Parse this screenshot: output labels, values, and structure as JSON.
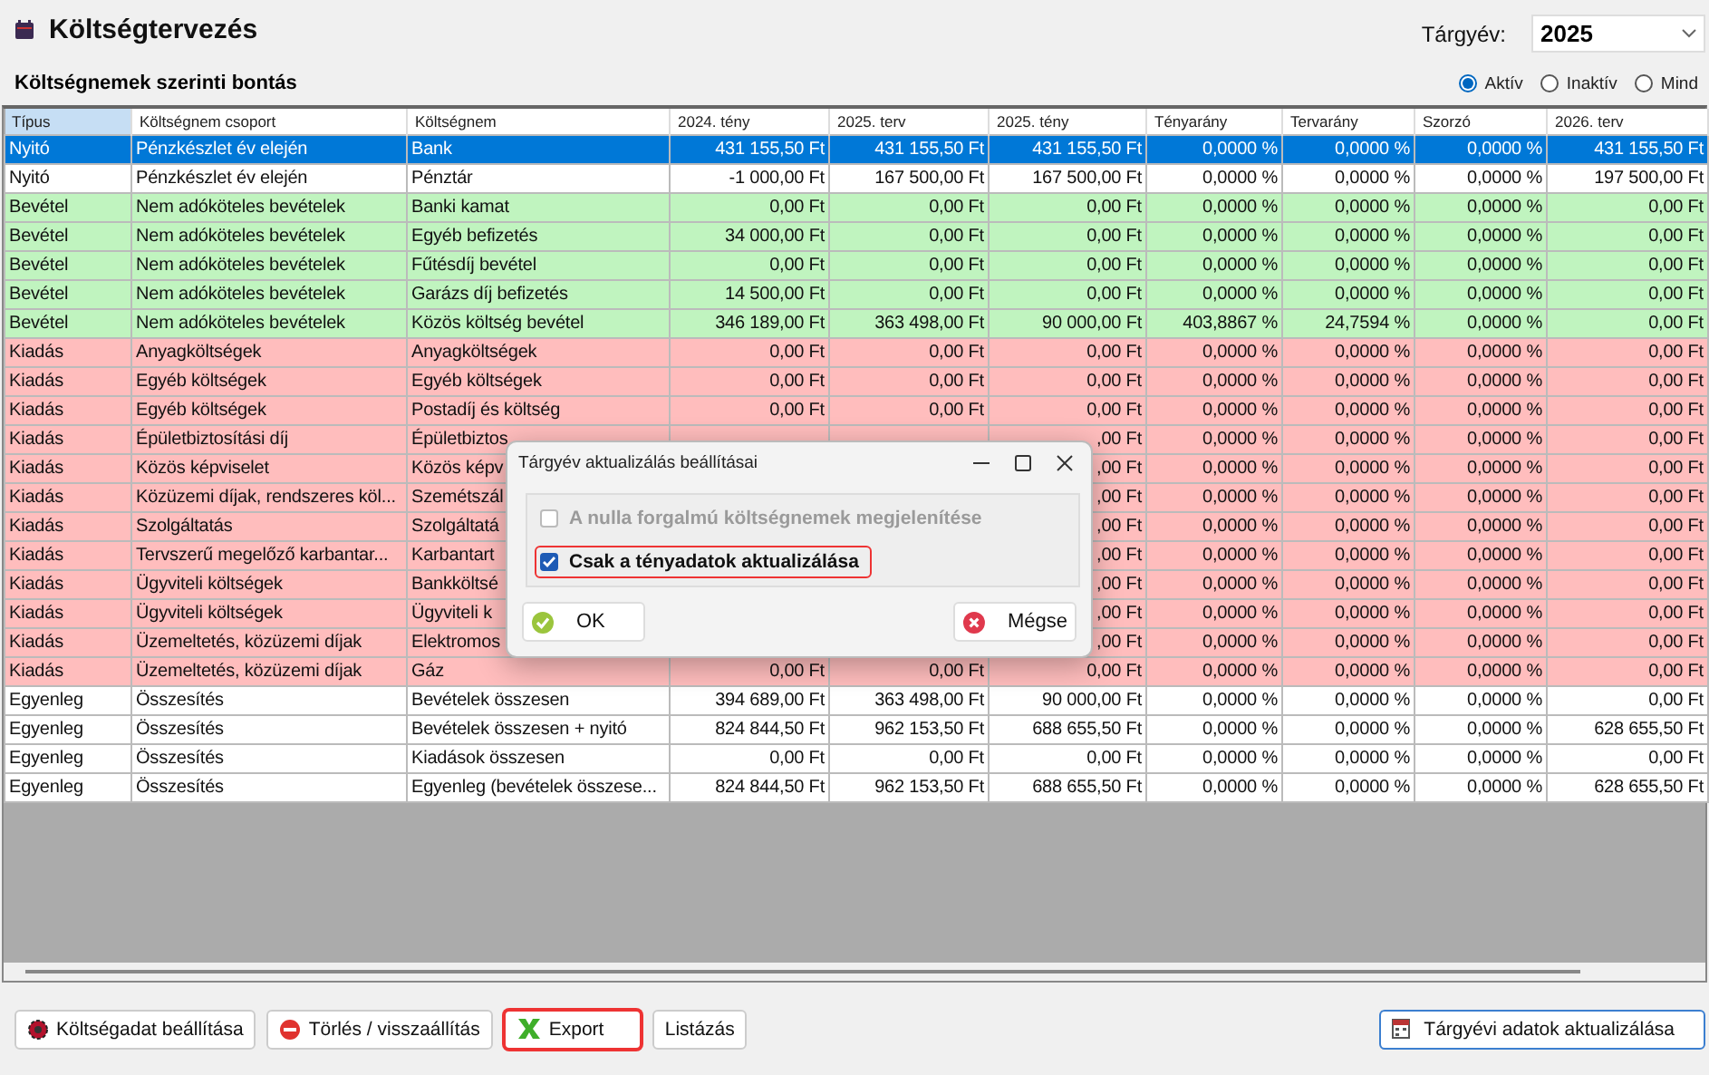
{
  "window": {
    "title": "Költségtervezés"
  },
  "year": {
    "label": "Tárgyév:",
    "value": "2025"
  },
  "section_title": "Költségnemek szerinti bontás",
  "filters": [
    {
      "label": "Aktív",
      "selected": true
    },
    {
      "label": "Inaktív",
      "selected": false
    },
    {
      "label": "Mind",
      "selected": false
    }
  ],
  "table": {
    "columns": [
      {
        "label": "Típus",
        "selected": true
      },
      {
        "label": "Költségnem csoport",
        "selected": false
      },
      {
        "label": "Költségnem",
        "selected": false
      },
      {
        "label": "2024. tény",
        "selected": false
      },
      {
        "label": "2025. terv",
        "selected": false
      },
      {
        "label": "2025. tény",
        "selected": false
      },
      {
        "label": "Tényarány",
        "selected": false
      },
      {
        "label": "Tervarány",
        "selected": false
      },
      {
        "label": "Szorzó",
        "selected": false
      },
      {
        "label": "2026. terv",
        "selected": false
      }
    ],
    "rows": [
      {
        "kind": "plain",
        "selected": true,
        "cells": [
          "Nyitó",
          "Pénzkészlet év elején",
          "Bank",
          "431 155,50 Ft",
          "431 155,50 Ft",
          "431 155,50 Ft",
          "0,0000 %",
          "0,0000 %",
          "0,0000 %",
          "431 155,50 Ft"
        ]
      },
      {
        "kind": "plain",
        "selected": false,
        "cells": [
          "Nyitó",
          "Pénzkészlet év elején",
          "Pénztár",
          "-1 000,00 Ft",
          "167 500,00 Ft",
          "167 500,00 Ft",
          "0,0000 %",
          "0,0000 %",
          "0,0000 %",
          "197 500,00 Ft"
        ]
      },
      {
        "kind": "income",
        "selected": false,
        "cells": [
          "Bevétel",
          "Nem adóköteles bevételek",
          "Banki kamat",
          "0,00 Ft",
          "0,00 Ft",
          "0,00 Ft",
          "0,0000 %",
          "0,0000 %",
          "0,0000 %",
          "0,00 Ft"
        ]
      },
      {
        "kind": "income",
        "selected": false,
        "cells": [
          "Bevétel",
          "Nem adóköteles bevételek",
          "Egyéb befizetés",
          "34 000,00 Ft",
          "0,00 Ft",
          "0,00 Ft",
          "0,0000 %",
          "0,0000 %",
          "0,0000 %",
          "0,00 Ft"
        ]
      },
      {
        "kind": "income",
        "selected": false,
        "cells": [
          "Bevétel",
          "Nem adóköteles bevételek",
          "Fűtésdíj bevétel",
          "0,00 Ft",
          "0,00 Ft",
          "0,00 Ft",
          "0,0000 %",
          "0,0000 %",
          "0,0000 %",
          "0,00 Ft"
        ]
      },
      {
        "kind": "income",
        "selected": false,
        "cells": [
          "Bevétel",
          "Nem adóköteles bevételek",
          "Garázs díj befizetés",
          "14 500,00 Ft",
          "0,00 Ft",
          "0,00 Ft",
          "0,0000 %",
          "0,0000 %",
          "0,0000 %",
          "0,00 Ft"
        ]
      },
      {
        "kind": "income",
        "selected": false,
        "cells": [
          "Bevétel",
          "Nem adóköteles bevételek",
          "Közös költség bevétel",
          "346 189,00 Ft",
          "363 498,00 Ft",
          "90 000,00 Ft",
          "403,8867 %",
          "24,7594 %",
          "0,0000 %",
          "0,00 Ft"
        ]
      },
      {
        "kind": "expense",
        "selected": false,
        "cells": [
          "Kiadás",
          "Anyagköltségek",
          "Anyagköltségek",
          "0,00 Ft",
          "0,00 Ft",
          "0,00 Ft",
          "0,0000 %",
          "0,0000 %",
          "0,0000 %",
          "0,00 Ft"
        ]
      },
      {
        "kind": "expense",
        "selected": false,
        "cells": [
          "Kiadás",
          "Egyéb költségek",
          "Egyéb költségek",
          "0,00 Ft",
          "0,00 Ft",
          "0,00 Ft",
          "0,0000 %",
          "0,0000 %",
          "0,0000 %",
          "0,00 Ft"
        ]
      },
      {
        "kind": "expense",
        "selected": false,
        "cells": [
          "Kiadás",
          "Egyéb költségek",
          "Postadíj és költség",
          "0,00 Ft",
          "0,00 Ft",
          "0,00 Ft",
          "0,0000 %",
          "0,0000 %",
          "0,0000 %",
          "0,00 Ft"
        ]
      },
      {
        "kind": "expense",
        "selected": false,
        "cells": [
          "Kiadás",
          "Épületbiztosítási díj",
          "Épületbiztos",
          null,
          null,
          ",00 Ft",
          "0,0000 %",
          "0,0000 %",
          "0,0000 %",
          "0,00 Ft"
        ]
      },
      {
        "kind": "expense",
        "selected": false,
        "cells": [
          "Kiadás",
          "Közös képviselet",
          "Közös képv",
          null,
          null,
          ",00 Ft",
          "0,0000 %",
          "0,0000 %",
          "0,0000 %",
          "0,00 Ft"
        ]
      },
      {
        "kind": "expense",
        "selected": false,
        "cells": [
          "Kiadás",
          "Közüzemi díjak, rendszeres köl...",
          "Szemétszál",
          null,
          null,
          ",00 Ft",
          "0,0000 %",
          "0,0000 %",
          "0,0000 %",
          "0,00 Ft"
        ]
      },
      {
        "kind": "expense",
        "selected": false,
        "cells": [
          "Kiadás",
          "Szolgáltatás",
          "Szolgáltatá",
          null,
          null,
          ",00 Ft",
          "0,0000 %",
          "0,0000 %",
          "0,0000 %",
          "0,00 Ft"
        ]
      },
      {
        "kind": "expense",
        "selected": false,
        "cells": [
          "Kiadás",
          "Tervszerű megelőző karbantar...",
          "Karbantart",
          null,
          null,
          ",00 Ft",
          "0,0000 %",
          "0,0000 %",
          "0,0000 %",
          "0,00 Ft"
        ]
      },
      {
        "kind": "expense",
        "selected": false,
        "cells": [
          "Kiadás",
          "Ügyviteli költségek",
          "Bankköltsé",
          null,
          null,
          ",00 Ft",
          "0,0000 %",
          "0,0000 %",
          "0,0000 %",
          "0,00 Ft"
        ]
      },
      {
        "kind": "expense",
        "selected": false,
        "cells": [
          "Kiadás",
          "Ügyviteli költségek",
          "Ügyviteli k",
          null,
          null,
          ",00 Ft",
          "0,0000 %",
          "0,0000 %",
          "0,0000 %",
          "0,00 Ft"
        ]
      },
      {
        "kind": "expense",
        "selected": false,
        "cells": [
          "Kiadás",
          "Üzemeltetés, közüzemi díjak",
          "Elektromos",
          null,
          null,
          ",00 Ft",
          "0,0000 %",
          "0,0000 %",
          "0,0000 %",
          "0,00 Ft"
        ]
      },
      {
        "kind": "expense",
        "selected": false,
        "cells": [
          "Kiadás",
          "Üzemeltetés, közüzemi díjak",
          "Gáz",
          "0,00 Ft",
          "0,00 Ft",
          "0,00 Ft",
          "0,0000 %",
          "0,0000 %",
          "0,0000 %",
          "0,00 Ft"
        ]
      },
      {
        "kind": "plain",
        "selected": false,
        "cells": [
          "Egyenleg",
          "Összesítés",
          "Bevételek összesen",
          "394 689,00 Ft",
          "363 498,00 Ft",
          "90 000,00 Ft",
          "0,0000 %",
          "0,0000 %",
          "0,0000 %",
          "0,00 Ft"
        ]
      },
      {
        "kind": "plain",
        "selected": false,
        "cells": [
          "Egyenleg",
          "Összesítés",
          "Bevételek összesen + nyitó",
          "824 844,50 Ft",
          "962 153,50 Ft",
          "688 655,50 Ft",
          "0,0000 %",
          "0,0000 %",
          "0,0000 %",
          "628 655,50 Ft"
        ]
      },
      {
        "kind": "plain",
        "selected": false,
        "cells": [
          "Egyenleg",
          "Összesítés",
          "Kiadások összesen",
          "0,00 Ft",
          "0,00 Ft",
          "0,00 Ft",
          "0,0000 %",
          "0,0000 %",
          "0,0000 %",
          "0,00 Ft"
        ]
      },
      {
        "kind": "plain",
        "selected": false,
        "cells": [
          "Egyenleg",
          "Összesítés",
          "Egyenleg (bevételek összese...",
          "824 844,50 Ft",
          "962 153,50 Ft",
          "688 655,50 Ft",
          "0,0000 %",
          "0,0000 %",
          "0,0000 %",
          "628 655,50 Ft"
        ]
      }
    ]
  },
  "buttons": [
    {
      "label": "Költségadat beállítása",
      "kind": "gear",
      "highlighted": false
    },
    {
      "label": "Törlés / visszaállítás",
      "kind": "delete",
      "highlighted": false
    },
    {
      "label": "Export",
      "kind": "excel",
      "highlighted": true
    },
    {
      "label": "Listázás",
      "kind": "none",
      "highlighted": false
    }
  ],
  "main_action": {
    "label": "Tárgyévi adatok aktualizálása",
    "focused": true
  },
  "dialog": {
    "title": "Tárgyév aktualizálás beállításai",
    "options": [
      {
        "label": "A nulla forgalmú költségnemek megjelenítése",
        "checked": false,
        "disabled": true,
        "highlighted": false
      },
      {
        "label": "Csak a tényadatok aktualizálása",
        "checked": true,
        "disabled": false,
        "highlighted": true
      }
    ],
    "ok": "OK",
    "cancel": "Mégse"
  }
}
